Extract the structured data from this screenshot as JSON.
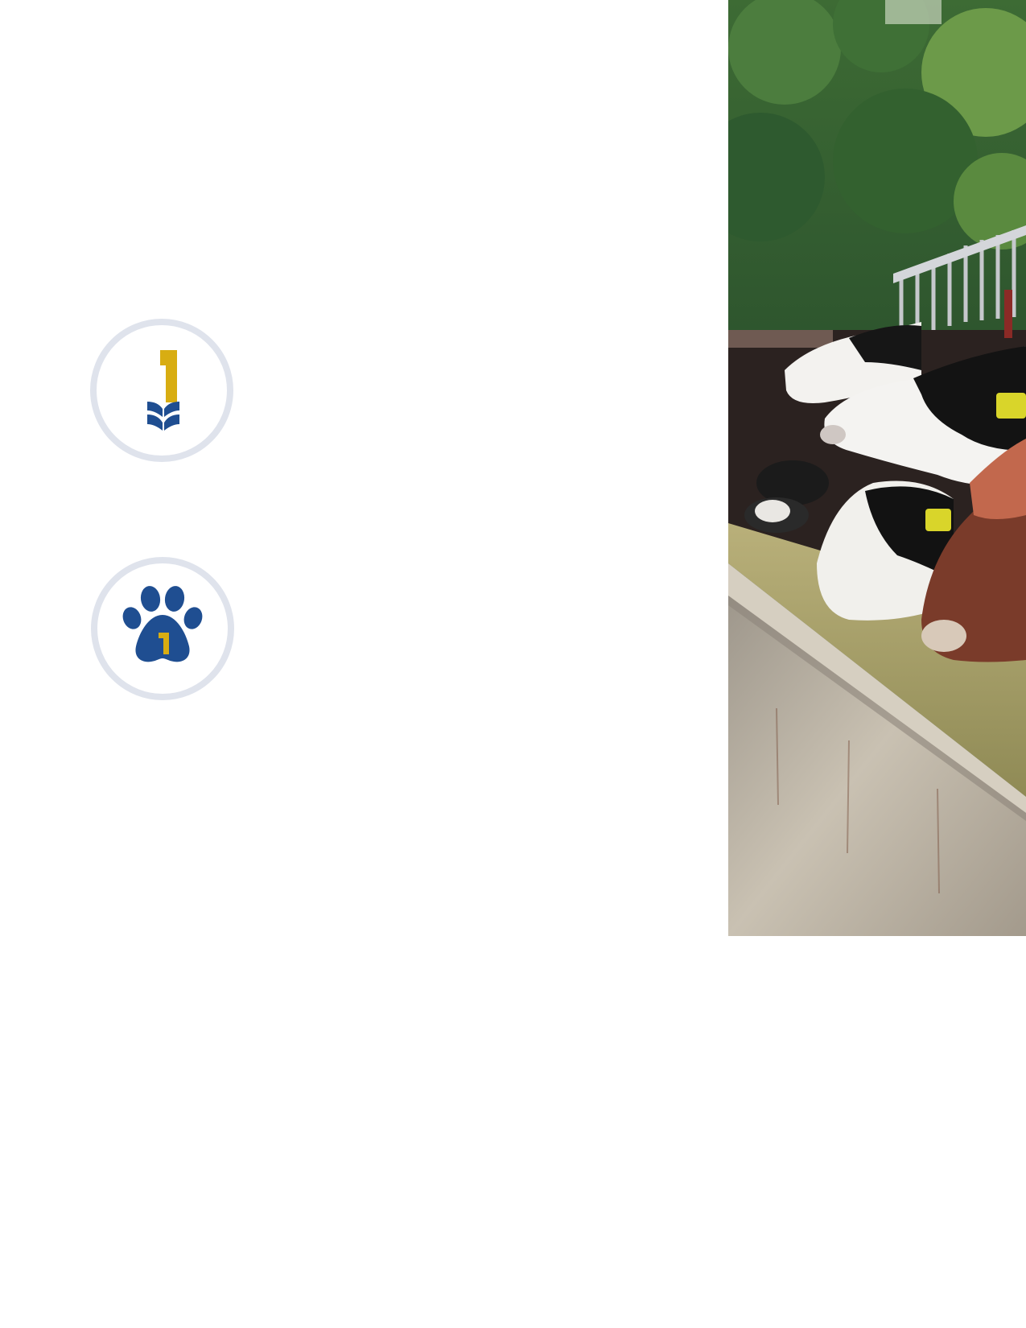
{
  "document": {
    "page_background": "#ffffff"
  },
  "icons": [
    {
      "name": "grain-number-one-icon",
      "colors": {
        "ring": "#dfe3ec",
        "gold": "#d8ad12",
        "blue": "#1f4e91"
      }
    },
    {
      "name": "paw-number-one-icon",
      "colors": {
        "ring": "#dfe3ec",
        "gold": "#d8ad12",
        "blue": "#1f4e91"
      }
    }
  ],
  "photo": {
    "subject": "cows-feeding-at-trough-photo",
    "ear_tag_color": "#d9d52a"
  }
}
